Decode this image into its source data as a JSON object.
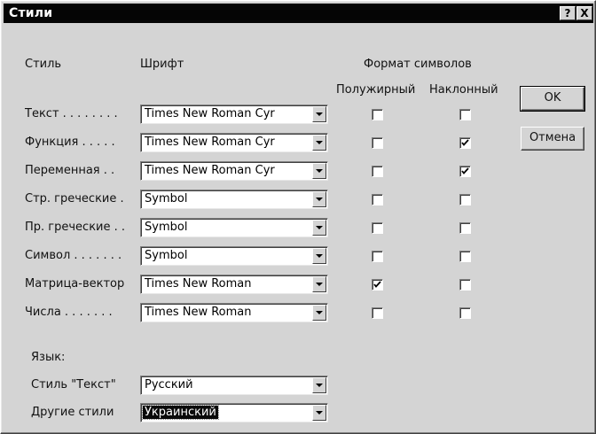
{
  "window": {
    "title": "Стили",
    "help_label": "?",
    "close_label": "X"
  },
  "headers": {
    "style": "Стиль",
    "font": "Шрифт",
    "char_format": "Формат символов",
    "bold": "Полужирный",
    "italic": "Наклонный"
  },
  "rows": [
    {
      "label": "Текст . . . . . . . .",
      "font": "Times New Roman Cyr",
      "bold": false,
      "italic": false
    },
    {
      "label": "Функция . . . . .",
      "font": "Times New Roman Cyr",
      "bold": false,
      "italic": true
    },
    {
      "label": "Переменная . .",
      "font": "Times New Roman Cyr",
      "bold": false,
      "italic": true
    },
    {
      "label": "Стр. греческие .",
      "font": "Symbol",
      "bold": false,
      "italic": false
    },
    {
      "label": "Пр. греческие . .",
      "font": "Symbol",
      "bold": false,
      "italic": false
    },
    {
      "label": "Символ . . . . . . .",
      "font": "Symbol",
      "bold": false,
      "italic": false
    },
    {
      "label": "Матрица-вектор",
      "font": "Times New Roman",
      "bold": true,
      "italic": false
    },
    {
      "label": "Числа . . . . . . .",
      "font": "Times New Roman",
      "bold": false,
      "italic": false
    }
  ],
  "language": {
    "header": "Язык:",
    "text_style_label": "Стиль \"Текст\"",
    "text_style_value": "Русский",
    "other_styles_label": "Другие стили",
    "other_styles_value": "Украинский"
  },
  "buttons": {
    "ok": "OK",
    "cancel": "Отмена"
  },
  "icons": {
    "dropdown": "chevron-down-icon",
    "check": "checkmark-icon"
  }
}
